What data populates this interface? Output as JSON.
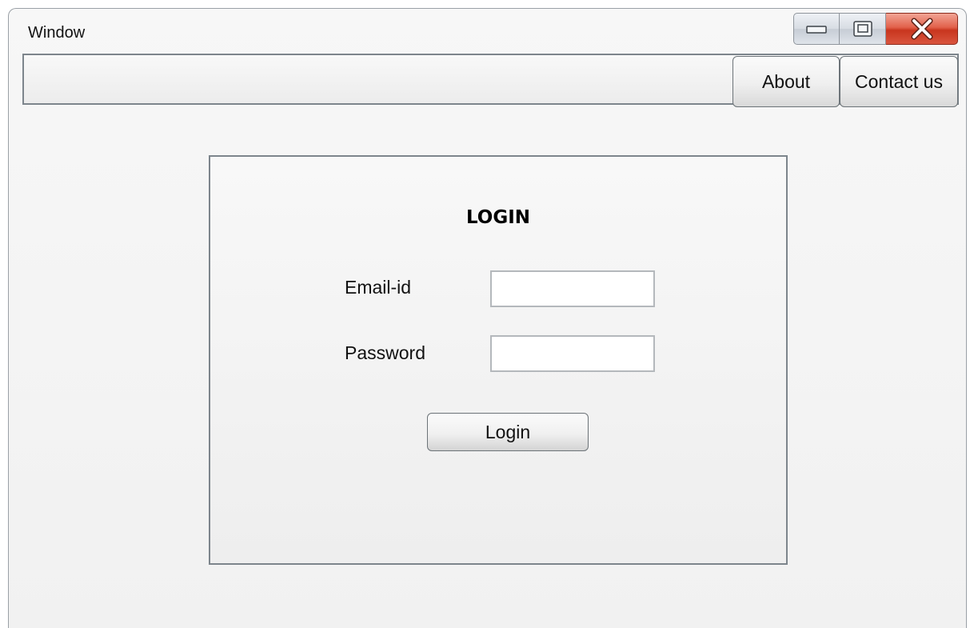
{
  "window": {
    "title": "Window",
    "controls": {
      "minimize_icon": "minimize-icon",
      "maximize_icon": "maximize-icon",
      "close_icon": "close-icon",
      "close_color": "#d9482f"
    }
  },
  "menu": {
    "items": [
      {
        "label": "About"
      },
      {
        "label": "Contact us"
      }
    ]
  },
  "login": {
    "title": "LOGIN",
    "email_label": "Email-id",
    "email_value": "",
    "password_label": "Password",
    "password_value": "",
    "submit_label": "Login"
  }
}
